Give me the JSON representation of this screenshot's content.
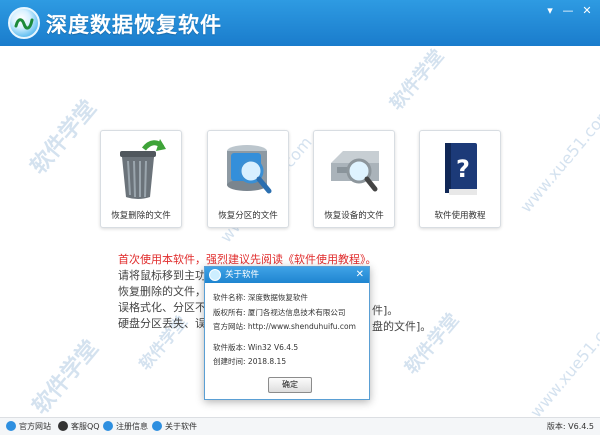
{
  "app": {
    "title": "深度数据恢复软件"
  },
  "window_controls": {
    "menu": "▾",
    "minimize": "—",
    "close": "✕"
  },
  "cards": [
    {
      "label": "恢复删除的文件",
      "icon": "trash-icon"
    },
    {
      "label": "恢复分区的文件",
      "icon": "drive-search-icon"
    },
    {
      "label": "恢复设备的文件",
      "icon": "device-search-icon"
    },
    {
      "label": "软件使用教程",
      "icon": "help-book-icon"
    }
  ],
  "hints": {
    "line1": "首次使用本软件，强烈建议先阅读《软件使用教程》。",
    "line2": "请将鼠标移到主功能按",
    "line3": "恢复删除的文件，请点",
    "line4": "误格式化、分区不能打",
    "line4_end": "件]。",
    "line5": "硬盘分区丢失、误分区",
    "line5_end": "盘的文件]。"
  },
  "dialog": {
    "title": "关于软件",
    "close": "✕",
    "name_label": "软件名称:",
    "name_value": "深度数据恢复软件",
    "copyright_label": "版权所有:",
    "copyright_value": "厦门各视达信息技术有限公司",
    "website_label": "官方网站:",
    "website_value": "http://www.shenduhuifu.com",
    "version_label": "软件版本:",
    "version_value": "Win32 V6.4.5",
    "created_label": "创建时间:",
    "created_value": "2018.8.15",
    "ok": "确定"
  },
  "statusbar": {
    "items": [
      "官方网站",
      "客服QQ",
      "注册信息",
      "关于软件"
    ],
    "version": "版本: V6.4.5"
  },
  "watermarks": [
    "软件学堂",
    "www.xue51.com"
  ],
  "colors": {
    "titlebar": "#1a7ccc",
    "warning": "#e02b2b",
    "accent": "#2e9be2"
  }
}
